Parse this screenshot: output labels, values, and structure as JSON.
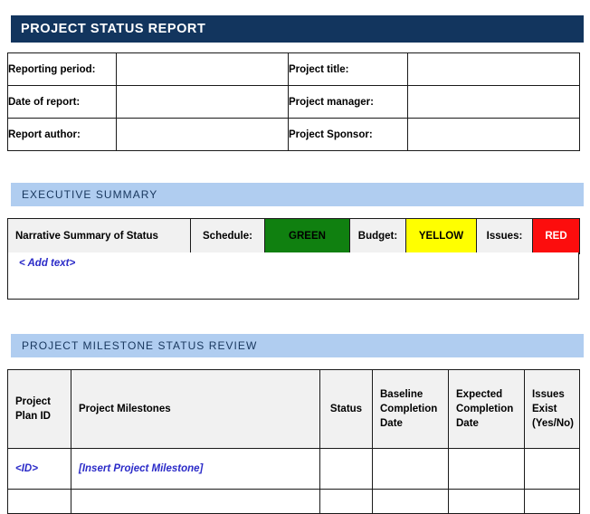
{
  "document": {
    "title": "PROJECT STATUS REPORT"
  },
  "colors": {
    "title_bar": "#12355e",
    "section_bar": "#b0cdf0",
    "section_text": "#17365d",
    "label_cell": "#f1f1f1",
    "status_green": "#108010",
    "status_yellow": "#ffff00",
    "status_red": "#fc0d0d",
    "placeholder_text": "#2b2bc8",
    "border": "#1a1a1a"
  },
  "info_table": {
    "rows": [
      {
        "left_label": "Reporting period:",
        "left_value": "",
        "right_label": "Project title:",
        "right_value": ""
      },
      {
        "left_label": "Date of report:",
        "left_value": "",
        "right_label": "Project manager:",
        "right_value": ""
      },
      {
        "left_label": "Report author:",
        "left_value": "",
        "right_label": "Project Sponsor:",
        "right_value": ""
      }
    ]
  },
  "executive_summary": {
    "section_title": "EXECUTIVE SUMMARY",
    "narrative_header": "Narrative Summary of Status",
    "indicators": [
      {
        "label": "Schedule:",
        "value": "GREEN",
        "color": "#108010"
      },
      {
        "label": "Budget:",
        "value": "YELLOW",
        "color": "#ffff00"
      },
      {
        "label": "Issues:",
        "value": "RED",
        "color": "#fc0d0d"
      }
    ],
    "narrative_placeholder": "< Add text>"
  },
  "milestone_review": {
    "section_title": "PROJECT MILESTONE STATUS REVIEW",
    "headers": {
      "plan_id": "Project\nPlan ID",
      "plan_id_line1": "Project",
      "plan_id_line2": "Plan ID",
      "milestones": "Project Milestones",
      "status": "Status",
      "baseline_line1": "Baseline",
      "baseline_line2": "Completion",
      "baseline_line3": "Date",
      "expected_line1": "Expected",
      "expected_line2": "Completion",
      "expected_line3": "Date",
      "issues_line1": "Issues",
      "issues_line2": "Exist",
      "issues_line3": "(Yes/No)"
    },
    "rows": [
      {
        "plan_id": "<ID>",
        "milestone": "[Insert Project Milestone]",
        "status": "",
        "baseline_completion_date": "",
        "expected_completion_date": "",
        "issues_exist": ""
      }
    ]
  }
}
